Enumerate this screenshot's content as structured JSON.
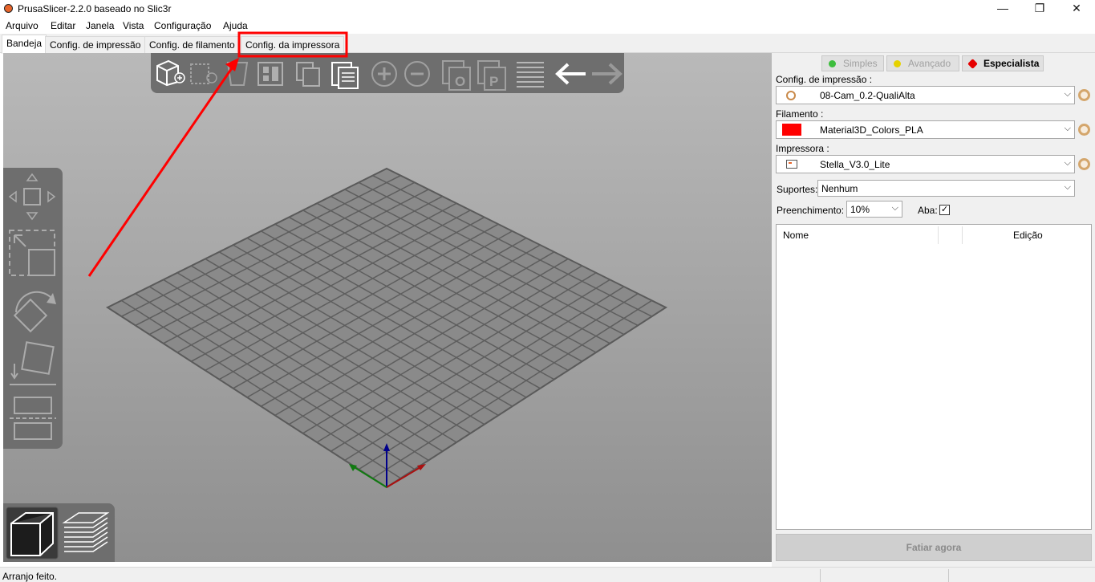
{
  "window": {
    "title": "PrusaSlicer-2.2.0 baseado no Slic3r",
    "minimize_glyph": "—",
    "maximize_glyph": "❐",
    "close_glyph": "✕"
  },
  "menu": [
    "Arquivo",
    "Editar",
    "Janela",
    "Vista",
    "Configuração",
    "Ajuda"
  ],
  "tabs": [
    {
      "label": "Bandeja",
      "active": true
    },
    {
      "label": "Config. de impressão",
      "active": false
    },
    {
      "label": "Config. de filamento",
      "active": false
    },
    {
      "label": "Config. da impressora",
      "active": false,
      "highlighted": true
    }
  ],
  "viewport": {
    "top_toolbar_icons": [
      "add-icon",
      "delete-icon",
      "delete-all-icon",
      "arrange-icon",
      "copy-icon",
      "paste-icon",
      "add-instance-icon",
      "remove-instance-icon",
      "split-objects-icon",
      "split-parts-icon",
      "layers-editing-icon",
      "undo-icon",
      "redo-icon"
    ],
    "left_toolbar_icons": [
      "move-icon",
      "scale-icon",
      "rotate-icon",
      "place-on-face-icon",
      "cut-icon"
    ],
    "bottom_toolbar_icons": [
      "3d-view-icon",
      "preview-layers-icon"
    ],
    "bed_grid_divisions": 20
  },
  "sidebar": {
    "modes": [
      {
        "label": "Simples",
        "color": "#3dbd3d",
        "enabled": false
      },
      {
        "label": "Avançado",
        "color": "#e6d200",
        "enabled": false
      },
      {
        "label": "Especialista",
        "color": "#e60000",
        "enabled": true,
        "selected": true
      }
    ],
    "print_settings_label": "Config. de impressão :",
    "print_settings_value": "08-Cam_0.2-QualiAlta",
    "filament_label": "Filamento :",
    "filament_value": "Material3D_Colors_PLA",
    "filament_color": "#ff0000",
    "printer_label": "Impressora :",
    "printer_value": "Stella_V3.0_Lite",
    "supports_label": "Suportes:",
    "supports_value": "Nenhum",
    "infill_label": "Preenchimento:",
    "infill_value": "10%",
    "brim_label": "Aba:",
    "brim_checked": true,
    "checkmark": "✓",
    "object_list_columns": [
      "Nome",
      "",
      "Edição"
    ],
    "slice_button": "Fatiar agora"
  },
  "status": {
    "text": "Arranjo feito."
  },
  "annotation": {
    "color": "#ff0000"
  }
}
